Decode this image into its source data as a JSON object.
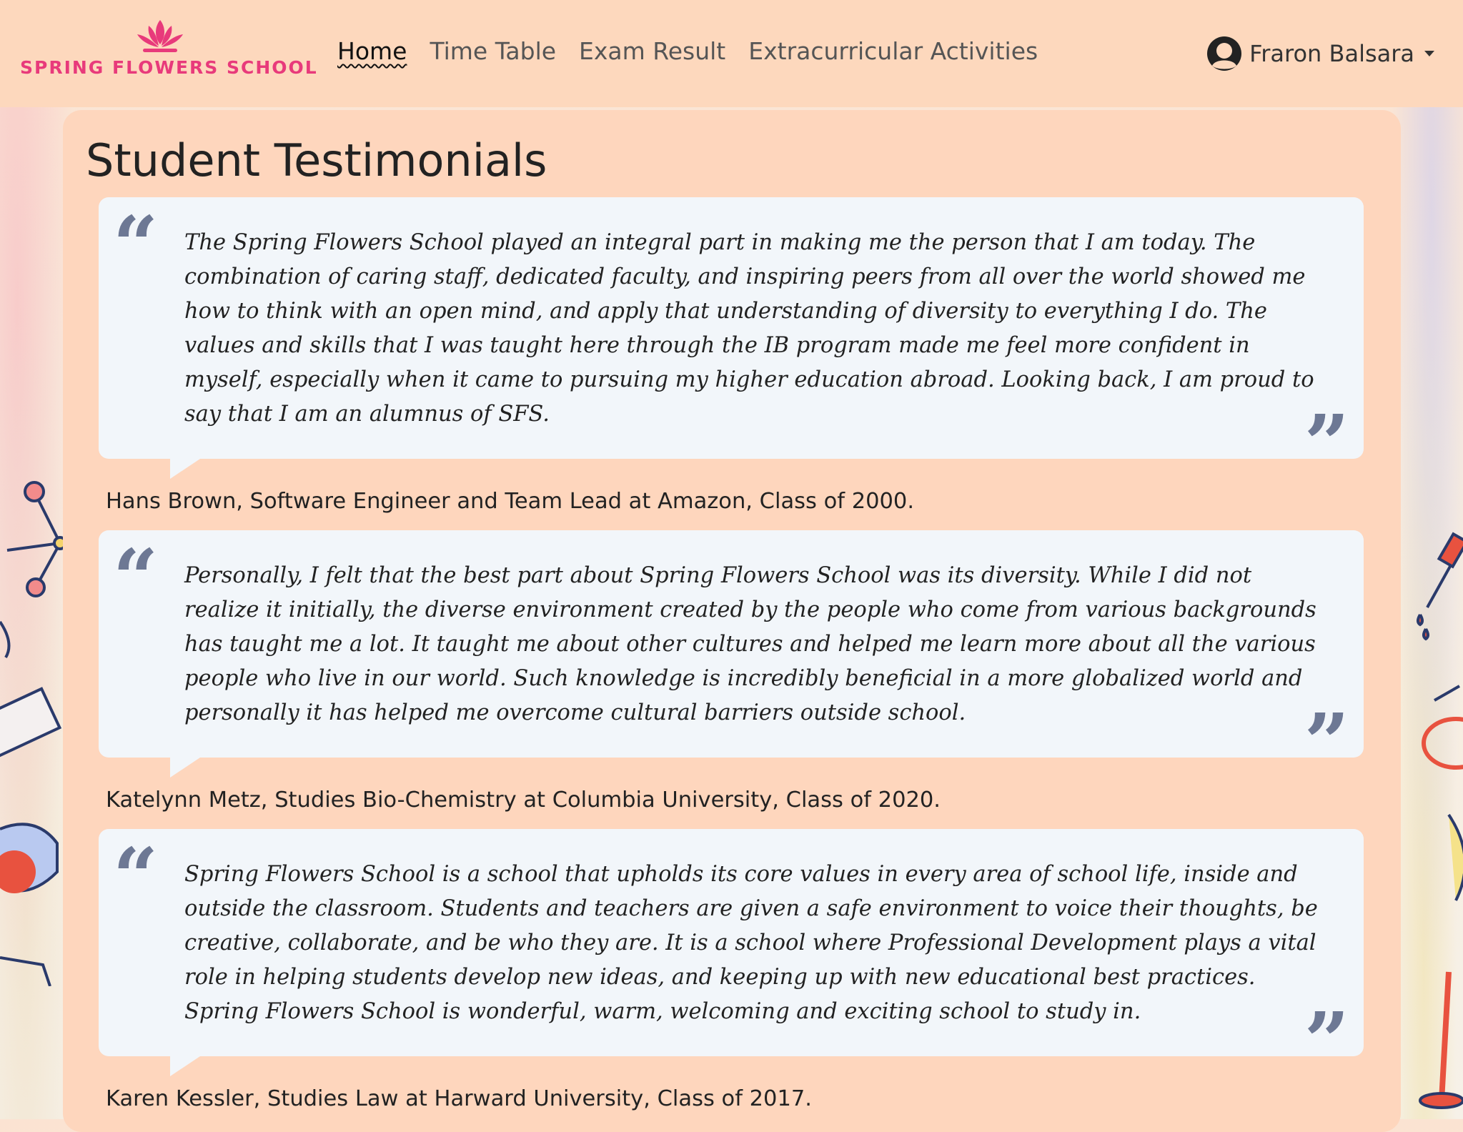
{
  "brand": {
    "name": "SPRING FLOWERS SCHOOL",
    "accent_color": "#e83a7b"
  },
  "nav": {
    "items": [
      {
        "label": "Home",
        "active": true
      },
      {
        "label": "Time Table",
        "active": false
      },
      {
        "label": "Exam Result",
        "active": false
      },
      {
        "label": "Extracurricular Activities",
        "active": false
      }
    ]
  },
  "user": {
    "name": "Fraron Balsara",
    "icon": "user-avatar-icon"
  },
  "page": {
    "title": "Student Testimonials"
  },
  "testimonials": [
    {
      "text": "The Spring Flowers School played an integral part in making me the person that I am today. The combination of caring staff, dedicated faculty, and inspiring peers from all over the world showed me how to think with an open mind, and apply that understanding of diversity to everything I do. The values and skills that I was taught here through the IB program made me feel more confident in myself, especially when it came to pursuing my higher education abroad. Looking back, I am proud to say that I am an alumnus of SFS.",
      "author": "Hans Brown, Software Engineer and Team Lead at Amazon, Class of 2000."
    },
    {
      "text": "Personally, I felt that the best part about Spring Flowers School was its diversity. While I did not realize it initially, the diverse environment created by the people who come from various backgrounds has taught me a lot. It taught me about other cultures and helped me learn more about all the various people who live in our world. Such knowledge is incredibly beneficial in a more globalized world and personally it has helped me overcome cultural barriers outside school.",
      "author": "Katelynn Metz, Studies Bio-Chemistry at Columbia University, Class of 2020."
    },
    {
      "text": "Spring Flowers School is a school that upholds its core values in every area of school life, inside and outside the classroom. Students and teachers are given a safe environment to voice their thoughts, be creative, collaborate, and be who they are. It is a school where Professional Development plays a vital role in helping students develop new ideas, and keeping up with new educational best practices. Spring Flowers School is wonderful, warm, welcoming and exciting school to study in.",
      "author": "Karen Kessler, Studies Law at Harward University, Class of 2017."
    }
  ],
  "quote_marks": {
    "open": "“",
    "close": "”"
  },
  "colors": {
    "navbar_bg": "#fdd8bd",
    "panel_bg": "#fed6bd",
    "card_bg": "#f2f6fa",
    "quote_mark": "#6d7894"
  }
}
